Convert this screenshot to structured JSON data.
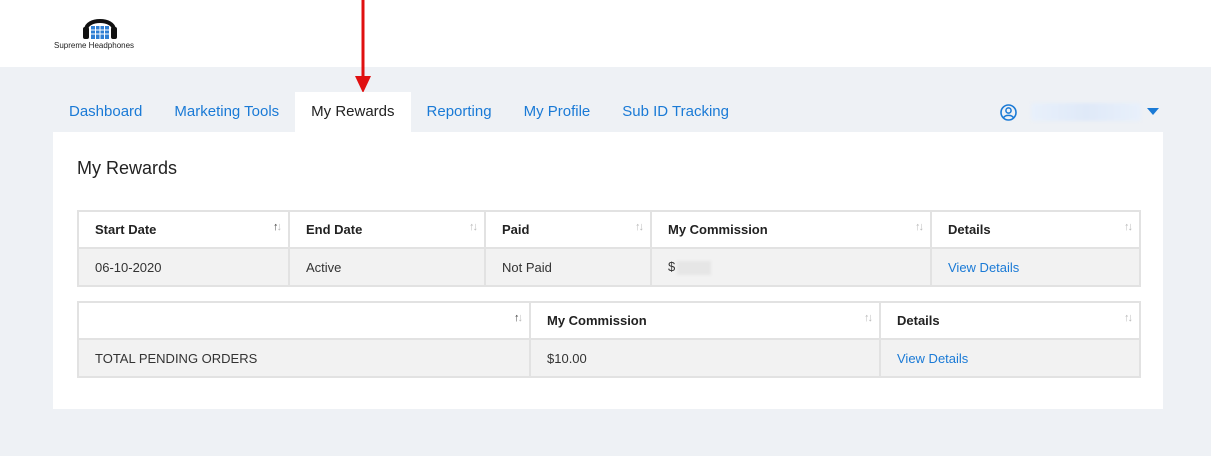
{
  "brand": {
    "name": "Supreme Headphones"
  },
  "nav": {
    "tabs": [
      {
        "label": "Dashboard"
      },
      {
        "label": "Marketing Tools"
      },
      {
        "label": "My Rewards"
      },
      {
        "label": "Reporting"
      },
      {
        "label": "My Profile"
      },
      {
        "label": "Sub ID Tracking"
      }
    ],
    "active_tab": "My Rewards"
  },
  "colors": {
    "link": "#1a7ad6",
    "annotation_arrow": "#e01010",
    "background": "#eef1f5"
  },
  "page": {
    "title": "My Rewards"
  },
  "rewards_table": {
    "headers": [
      "Start Date",
      "End Date",
      "Paid",
      "My Commission",
      "Details"
    ],
    "rows": [
      {
        "start_date": "06-10-2020",
        "end_date": "Active",
        "paid": "Not Paid",
        "commission": "$",
        "details": "View Details"
      }
    ]
  },
  "pending_table": {
    "headers": [
      "",
      "My Commission",
      "Details"
    ],
    "rows": [
      {
        "label": "TOTAL PENDING ORDERS",
        "commission": "$10.00",
        "details": "View Details"
      }
    ]
  }
}
